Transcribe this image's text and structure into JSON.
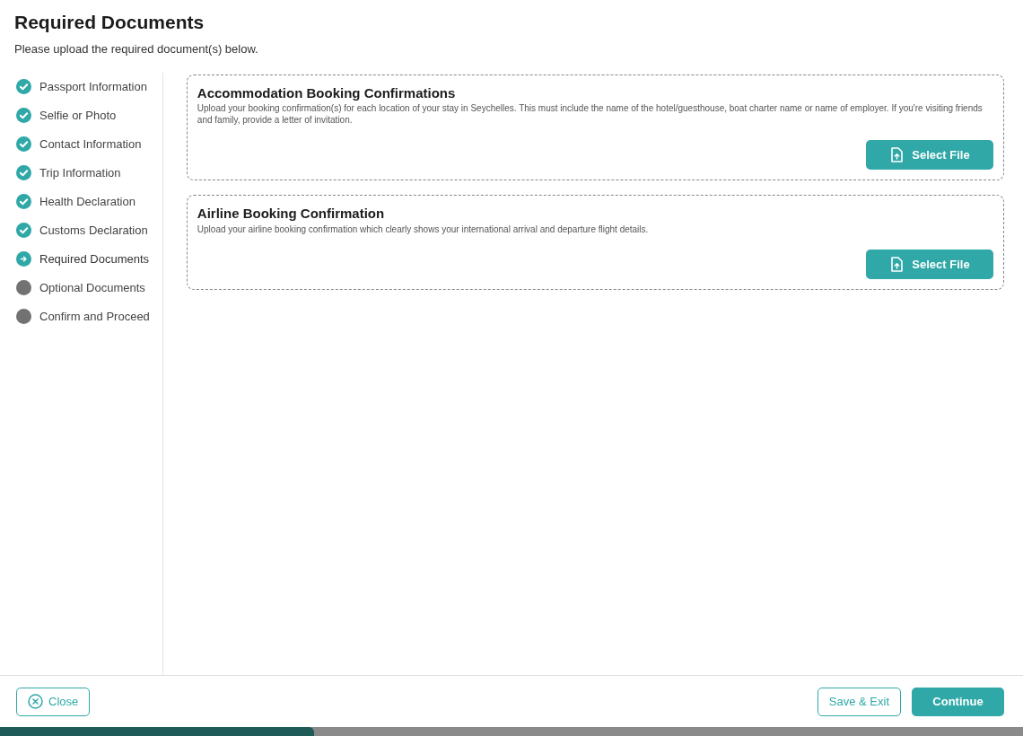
{
  "header": {
    "title": "Required Documents",
    "subtitle": "Please upload the required document(s) below."
  },
  "steps": [
    {
      "label": "Passport Information",
      "kind": "done"
    },
    {
      "label": "Selfie or Photo",
      "kind": "done"
    },
    {
      "label": "Contact Information",
      "kind": "done"
    },
    {
      "label": "Trip Information",
      "kind": "done"
    },
    {
      "label": "Health Declaration",
      "kind": "done"
    },
    {
      "label": "Customs Declaration",
      "kind": "done"
    },
    {
      "label": "Required Documents",
      "kind": "current"
    },
    {
      "label": "Optional Documents",
      "kind": "pending"
    },
    {
      "label": "Confirm and Proceed",
      "kind": "pending"
    }
  ],
  "documents": [
    {
      "title": "Accommodation Booking Confirmations",
      "description": "Upload your booking confirmation(s) for each location of your stay in Seychelles. This must include the name of the hotel/guesthouse, boat charter name or name of employer. If you're visiting friends and family, provide a letter of invitation.",
      "button": "Select File"
    },
    {
      "title": "Airline Booking Confirmation",
      "description": "Upload your airline booking confirmation which clearly shows your international arrival and departure flight details.",
      "button": "Select File"
    }
  ],
  "footer": {
    "close": "Close",
    "save": "Save & Exit",
    "continue": "Continue"
  }
}
